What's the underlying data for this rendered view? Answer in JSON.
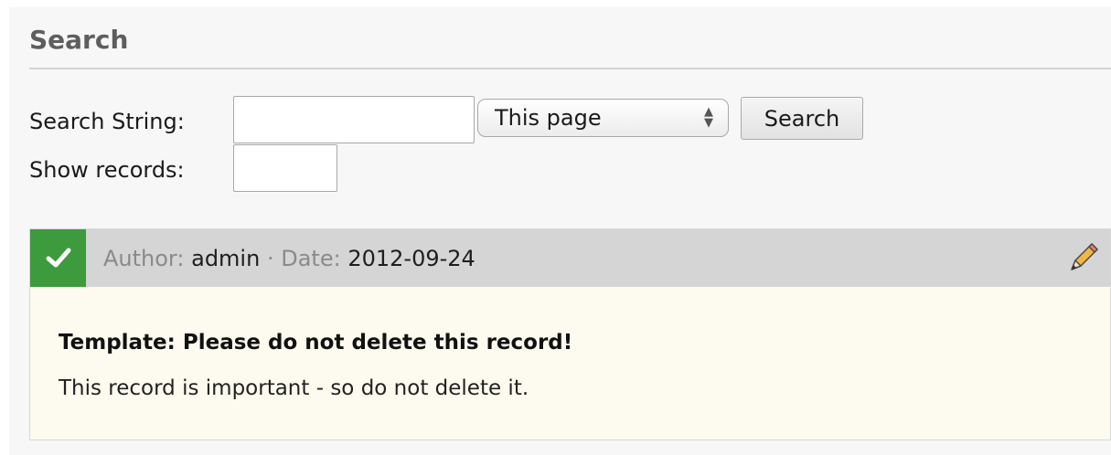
{
  "section": {
    "title": "Search"
  },
  "form": {
    "search_label": "Search String:",
    "search_value": "",
    "scope_selected": "This page",
    "search_button": "Search",
    "records_label": "Show records:",
    "records_value": ""
  },
  "record": {
    "status": "approved",
    "status_color": "#3d9a3d",
    "author_label": "Author:",
    "author": "admin",
    "separator": "·",
    "date_label": "Date:",
    "date": "2012-09-24",
    "title": "Template: Please do not delete this record!",
    "body": "This record is important - so do not delete it.",
    "edit_icon": "pencil-icon"
  }
}
